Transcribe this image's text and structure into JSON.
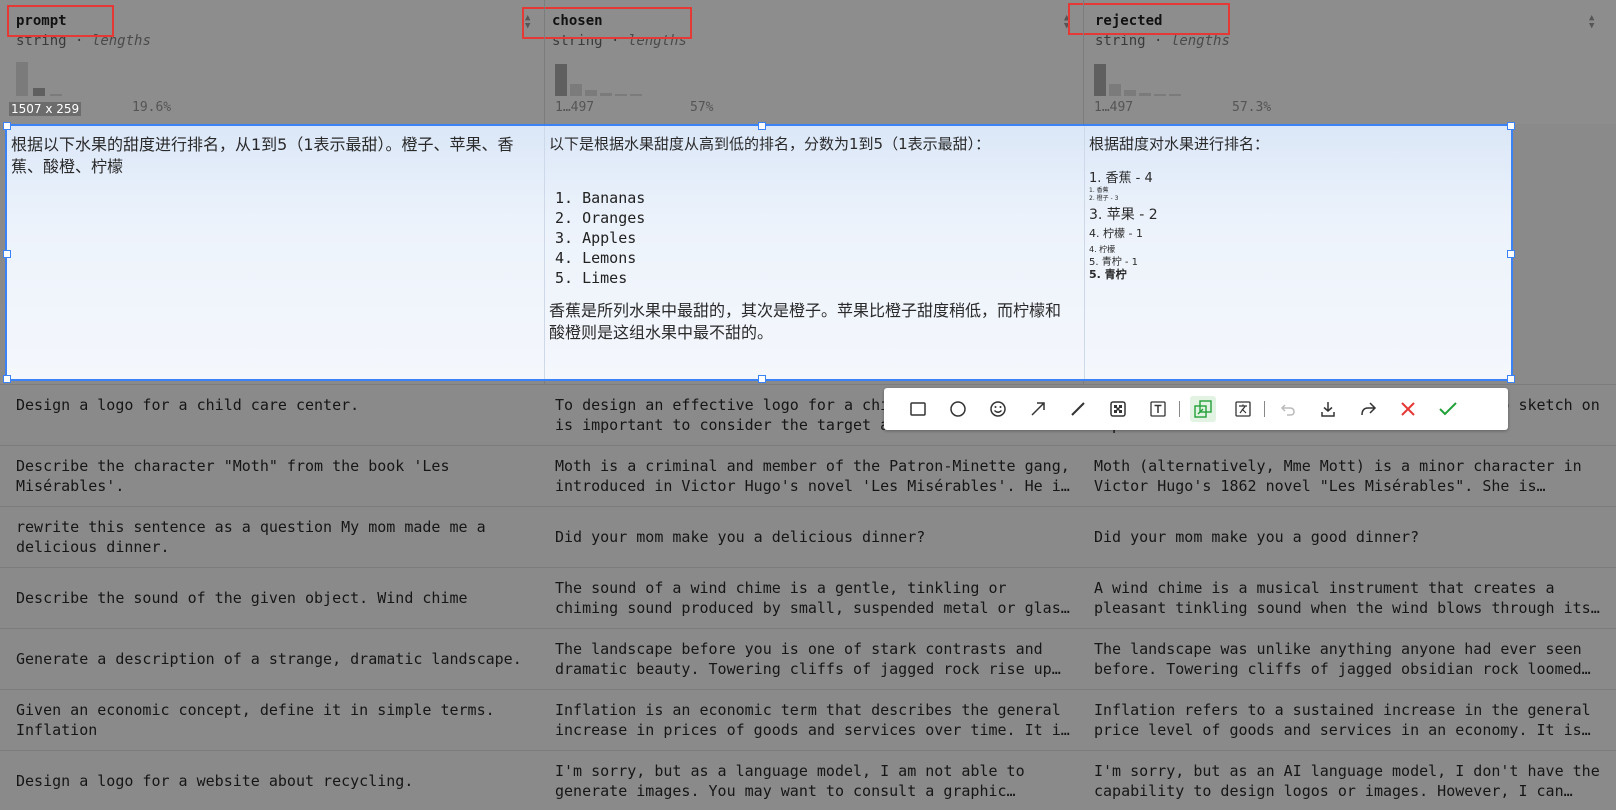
{
  "columns": [
    {
      "name": "prompt",
      "type": "string",
      "type_detail": "lengths",
      "range": "",
      "pct": "19.6%"
    },
    {
      "name": "chosen",
      "type": "string",
      "type_detail": "lengths",
      "range": "1…497",
      "pct": "57%"
    },
    {
      "name": "rejected",
      "type": "string",
      "type_detail": "lengths",
      "range": "1…497",
      "pct": "57.3%"
    }
  ],
  "type_separator": "·",
  "selection": {
    "dimensions": "1507 x 259",
    "prompt_text": "根据以下水果的甜度进行排名，从1到5（1表示最甜）。橙子、苹果、香蕉、酸橙、柠檬",
    "chosen_intro": "以下是根据水果甜度从高到低的排名，分数为1到5（1表示最甜）：",
    "chosen_list": [
      "1. Bananas",
      "2. Oranges",
      "3. Apples",
      "4. Lemons",
      "5. Limes"
    ],
    "chosen_outro": "香蕉是所列水果中最甜的，其次是橙子。苹果比橙子甜度稍低，而柠檬和酸橙则是这组水果中最不甜的。",
    "rejected_intro": "根据甜度对水果进行排名：",
    "rejected_lines": [
      "1. 香蕉 - 4",
      "1. 香蕉",
      "2. 橙子 - 3",
      "3. 苹果 - 2",
      "4. 柠檬 - 1",
      "4. 柠檬",
      "5. 青柠 - 1",
      "5. 青柠"
    ]
  },
  "rows": [
    {
      "prompt": "Design a logo for a child care center.",
      "chosen": "To design an effective logo for a child care center, it is important to consider the target audience and show…",
      "rejected": "…used for a child care center. I. Start a logo sketch on a piece of…"
    },
    {
      "prompt": "Describe the character \"Moth\" from the book 'Les Misérables'.",
      "chosen": "Moth is a criminal and member of the Patron-Minette gang, introduced in Victor Hugo's novel 'Les Misérables'. He i…",
      "rejected": "Moth (alternatively, Mme Mott) is a minor character in Victor Hugo's 1862 novel \"Les Misérables\". She is…"
    },
    {
      "prompt": "rewrite this sentence as a question My mom made me a delicious dinner.",
      "chosen": "Did your mom make you a delicious dinner?",
      "rejected": "Did your mom make you a good dinner?"
    },
    {
      "prompt": "Describe the sound of the given object. Wind chime",
      "chosen": "The sound of a wind chime is a gentle, tinkling or chiming sound produced by small, suspended metal or glas…",
      "rejected": "A wind chime is a musical instrument that creates a pleasant tinkling sound when the wind blows through its…"
    },
    {
      "prompt": "Generate a description of a strange, dramatic landscape.",
      "chosen": "The landscape before you is one of stark contrasts and dramatic beauty. Towering cliffs of jagged rock rise up…",
      "rejected": "The landscape was unlike anything anyone had ever seen before. Towering cliffs of jagged obsidian rock loomed…"
    },
    {
      "prompt": "Given an economic concept, define it in simple terms. Inflation",
      "chosen": "Inflation is an economic term that describes the general increase in prices of goods and services over time. It i…",
      "rejected": "Inflation refers to a sustained increase in the general price level of goods and services in an economy. It is…"
    },
    {
      "prompt": "Design a logo for a website about recycling.",
      "chosen": "I'm sorry, but as a language model, I am not able to generate images. You may want to consult a graphic…",
      "rejected": "I'm sorry, but as an AI language model, I don't have the capability to design logos or images. However, I can…"
    }
  ],
  "toolbar": {
    "tools": [
      "rectangle-icon",
      "ellipse-icon",
      "emoji-icon",
      "arrow-icon",
      "line-icon",
      "mosaic-icon",
      "text-icon",
      "pin-icon",
      "translate-icon",
      "undo-icon",
      "download-icon",
      "share-icon",
      "close-icon",
      "confirm-icon"
    ]
  },
  "colors": {
    "selection_border": "#3b82f6",
    "annotation_red": "#e53935",
    "confirm_green": "#22a03a"
  }
}
